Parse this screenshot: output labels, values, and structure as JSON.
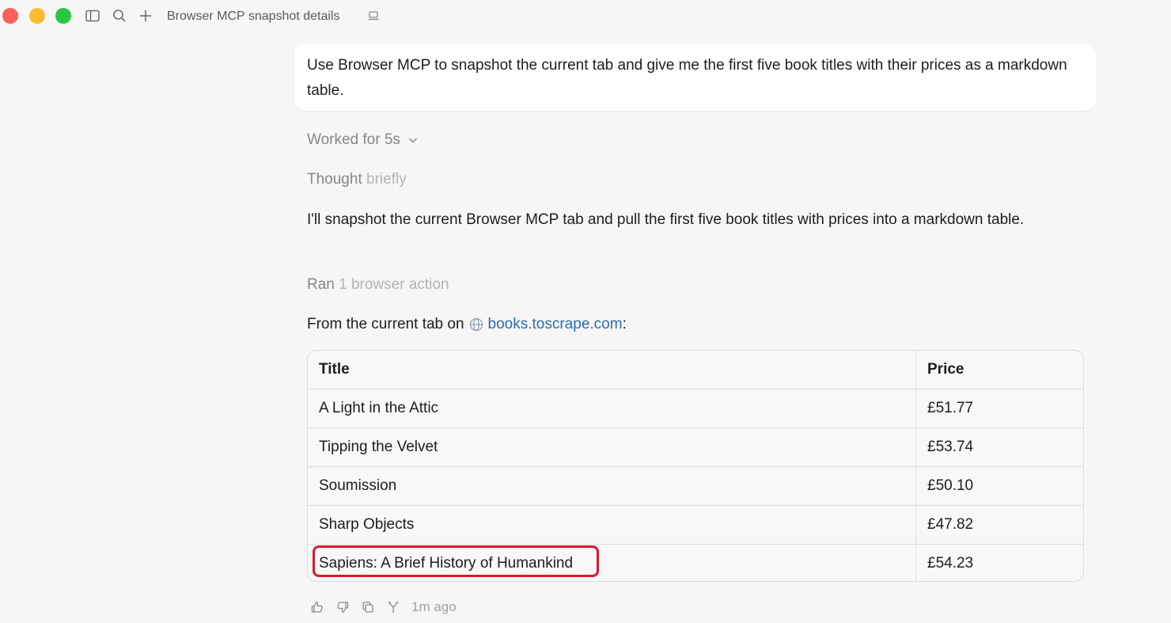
{
  "window": {
    "title": "Browser MCP snapshot details"
  },
  "chat": {
    "user_message": "Use Browser MCP to snapshot the current tab and give me the first five book titles with their prices as a markdown table.",
    "worked_label": "Worked for 5s",
    "thought_label": "Thought",
    "thought_detail": "briefly",
    "reply_text": "I'll snapshot the current Browser MCP tab and pull the first five book titles with prices into a markdown table.",
    "ran_label": "Ran",
    "ran_detail": "1 browser action",
    "from_prefix": "From the current tab on",
    "from_link": "books.toscrape.com",
    "from_suffix": ":",
    "timestamp": "1m ago"
  },
  "table": {
    "headers": [
      "Title",
      "Price"
    ],
    "rows": [
      {
        "title": "A Light in the Attic",
        "price": "£51.77"
      },
      {
        "title": "Tipping the Velvet",
        "price": "£53.74"
      },
      {
        "title": "Soumission",
        "price": "£50.10"
      },
      {
        "title": "Sharp Objects",
        "price": "£47.82"
      },
      {
        "title": "Sapiens: A Brief History of Humankind",
        "price": "£54.23"
      }
    ]
  },
  "colors": {
    "highlight": "#e0162b",
    "link": "#2b6cb0"
  }
}
